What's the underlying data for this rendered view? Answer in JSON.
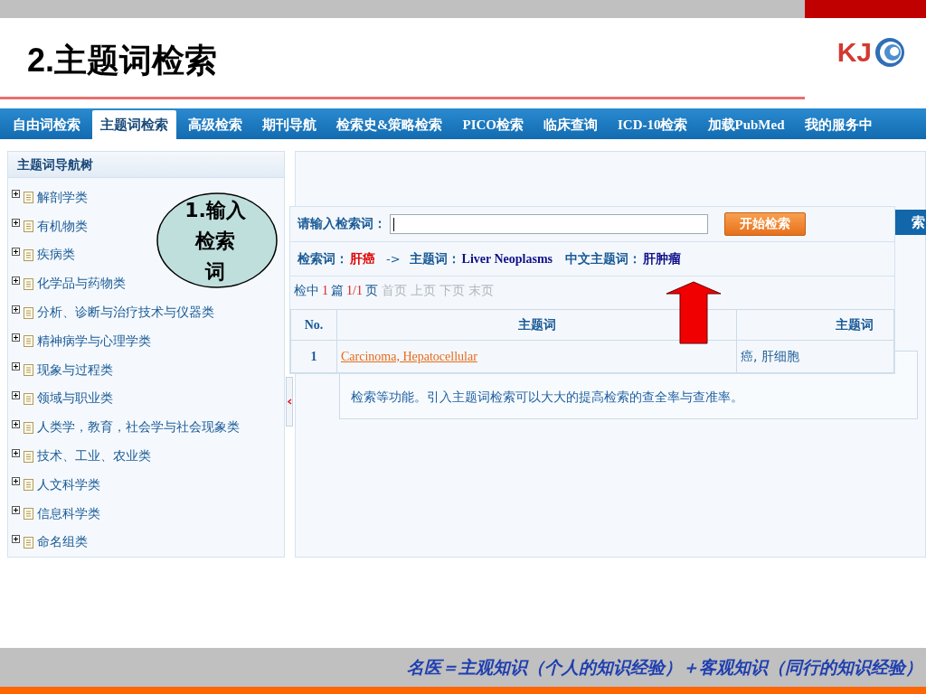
{
  "slide": {
    "title": "2.主题词检索",
    "logo": "KJ",
    "footer": "名医＝主观知识（个人的知识经验）＋客观知识（同行的知识经验）"
  },
  "nav": {
    "tabs": [
      {
        "label": "自由词检索",
        "selected": false
      },
      {
        "label": "主题词检索",
        "selected": true
      },
      {
        "label": "高级检索",
        "selected": false
      },
      {
        "label": "期刊导航",
        "selected": false
      },
      {
        "label": "检索史&策略检索",
        "selected": false
      },
      {
        "label": "PICO检索",
        "selected": false
      },
      {
        "label": "临床查询",
        "selected": false
      },
      {
        "label": "ICD-10检索",
        "selected": false
      },
      {
        "label": "加载PubMed",
        "selected": false
      },
      {
        "label": "我的服务中",
        "selected": false
      }
    ]
  },
  "sidebar": {
    "title": "主题词导航树",
    "items": [
      {
        "label": "解剖学类",
        "expanded": false
      },
      {
        "label": "有机物类",
        "expanded": false
      },
      {
        "label": "疾病类",
        "expanded": false
      },
      {
        "label": "化学品与药物类",
        "expanded": false
      },
      {
        "label": "分析、诊断与治疗技术与仪器类",
        "expanded": false
      },
      {
        "label": "精神病学与心理学类",
        "expanded": false
      },
      {
        "label": "现象与过程类",
        "expanded": false
      },
      {
        "label": "领域与职业类",
        "expanded": false
      },
      {
        "label": "人类学，教育，社会学与社会现象类",
        "expanded": false
      },
      {
        "label": "技术、工业、农业类",
        "expanded": false
      },
      {
        "label": "人文科学类",
        "expanded": false
      },
      {
        "label": "信息科学类",
        "expanded": false
      },
      {
        "label": "命名组类",
        "expanded": false
      }
    ]
  },
  "background": {
    "button_fragment": "索",
    "paragraph": "检索等功能。引入主题词检索可以大大的提高检索的查全率与查准率。"
  },
  "search_panel": {
    "label": "请输入检索词：",
    "button": "开始检索",
    "mapping": {
      "term_label": "检索词：",
      "term": "肝癌",
      "arrow": "->",
      "subject_label": "主题词：",
      "subject": "Liver Neoplasms",
      "cn_label": "中文主题词：",
      "cn_subject": "肝肿瘤"
    },
    "pager": {
      "prefix": "检中",
      "count": "1",
      "unit": "篇",
      "pages": "1/1",
      "suffix": "页",
      "links": [
        {
          "label": "首页",
          "disabled": true
        },
        {
          "label": "上页",
          "disabled": true
        },
        {
          "label": "下页",
          "disabled": true
        },
        {
          "label": "末页",
          "disabled": true
        }
      ]
    },
    "table": {
      "columns": [
        "No.",
        "主题词",
        "主题词"
      ],
      "rows": [
        {
          "cells": [
            "1",
            "Carcinoma, Hepatocellular",
            "癌, 肝细胞"
          ]
        }
      ]
    }
  },
  "callout": {
    "lines": [
      "1.输入",
      "检索",
      "词"
    ]
  }
}
